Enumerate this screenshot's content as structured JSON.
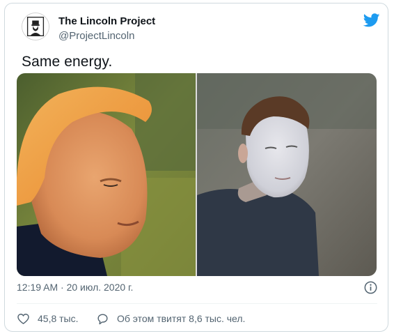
{
  "tweet": {
    "author_name": "The Lincoln Project",
    "author_handle": "@ProjectLincoln",
    "text": "Same energy.",
    "timestamp": "12:19 AM · 20 июл. 2020 г.",
    "likes_label": "45,8 тыс.",
    "reply_label": "Об этом твитят 8,6 тыс. чел."
  },
  "icons": {
    "avatar": "lincoln-silhouette-avatar",
    "brand": "twitter-bird-icon",
    "info": "info-icon",
    "like": "heart-icon",
    "reply": "comment-bubble-icon"
  },
  "colors": {
    "twitter_blue": "#1d9bf0",
    "text_primary": "#0f1419",
    "text_secondary": "#536471",
    "border": "#cfd9de"
  }
}
